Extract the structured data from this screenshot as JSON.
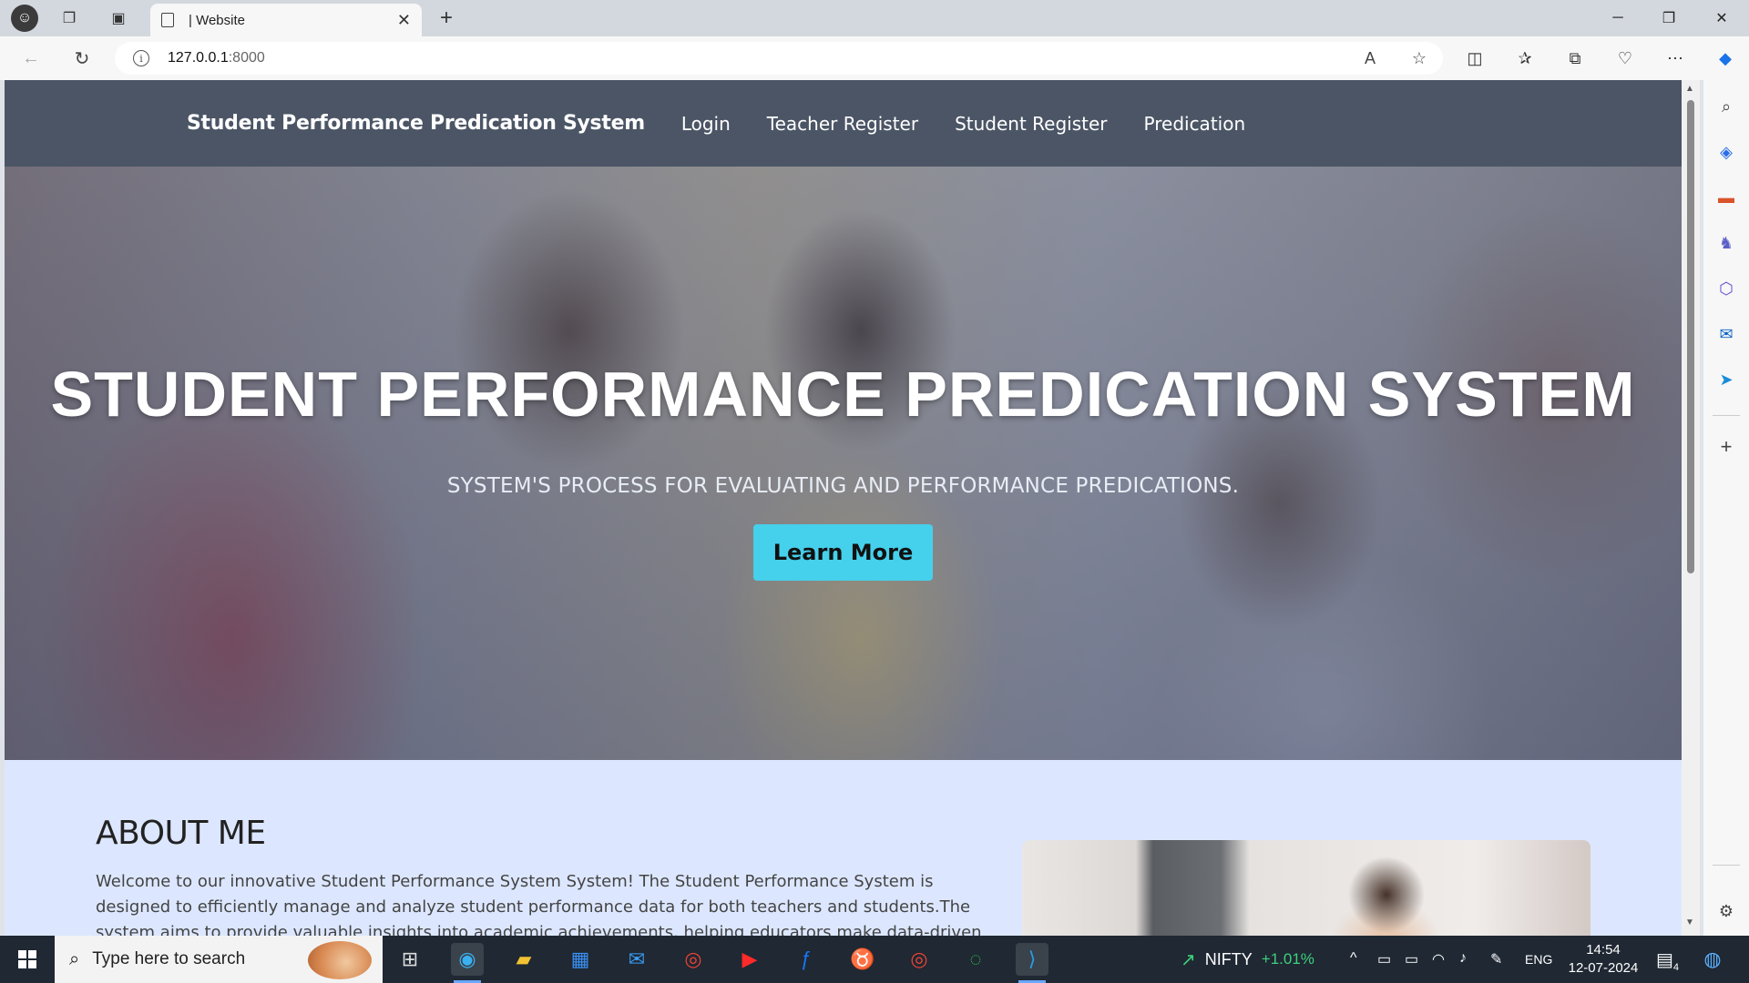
{
  "browser": {
    "tab_title": "| Website",
    "url_host": "127.0.0.1",
    "url_port": ":8000"
  },
  "site": {
    "brand": "Student Performance Predication System",
    "nav": [
      "Login",
      "Teacher Register",
      "Student Register",
      "Predication"
    ]
  },
  "hero": {
    "title": "STUDENT PERFORMANCE PREDICATION SYSTEM",
    "subtitle": "SYSTEM'S PROCESS FOR EVALUATING AND PERFORMANCE PREDICATIONS.",
    "button": "Learn More"
  },
  "about": {
    "title": "ABOUT ME",
    "text": "Welcome to our innovative Student Performance System System! The Student Performance System is designed to efficiently manage and analyze student performance data for both teachers and students.The system aims to provide valuable insights into academic achievements, helping educators make data-driven decisions and aiding students in"
  },
  "taskbar": {
    "search_placeholder": "Type here to search",
    "ticker_name": "NIFTY",
    "ticker_change": "+1.01%",
    "language": "ENG",
    "time": "14:54",
    "date": "12-07-2024",
    "notification_count": "4"
  },
  "colors": {
    "site_nav_bg": "#4b5565",
    "learn_more_bg": "#45d0ec",
    "about_bg": "#dce7ff",
    "taskbar_bg": "#1f2833",
    "ticker_up": "#3ed07c"
  }
}
